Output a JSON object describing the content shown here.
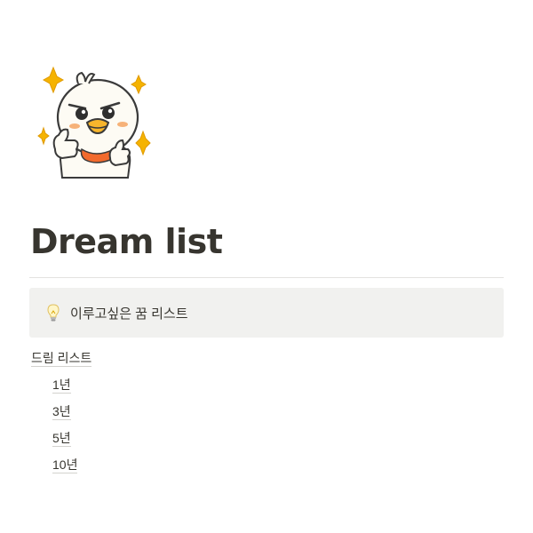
{
  "page": {
    "icon": "duck-thumbs-up-sticker-icon",
    "title": "Dream list"
  },
  "callout": {
    "icon": "light-bulb-icon",
    "text": "이루고싶은 꿈 리스트"
  },
  "toc": {
    "heading": "드림 리스트",
    "items": [
      "1년",
      "3년",
      "5년",
      "10년"
    ]
  },
  "colors": {
    "text": "#37352f",
    "callout_bg": "#f1f1ef",
    "divider": "#e3e2e0",
    "sparkle": "#f5b301",
    "scarf": "#f26a2d",
    "beak": "#f7b52c"
  }
}
